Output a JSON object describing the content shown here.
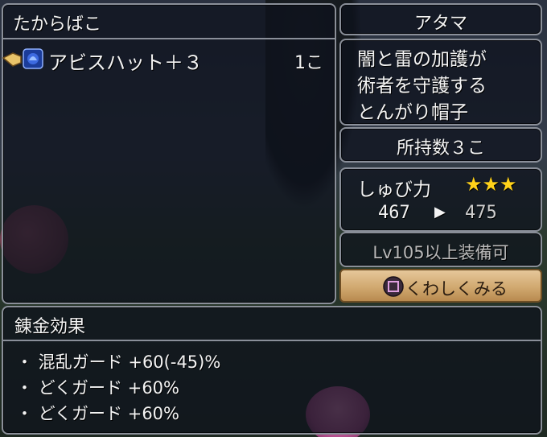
{
  "chest_panel": {
    "title": "たからばこ",
    "item_name": "アビスハット＋３",
    "item_count": "1こ"
  },
  "slot_panel": {
    "label": "アタマ"
  },
  "description": {
    "lines": [
      "闇と雷の加護が",
      "術者を守護する",
      "とんがり帽子"
    ]
  },
  "owned": {
    "text": "所持数３こ"
  },
  "defense": {
    "label": "しゅび力",
    "stars": "★★★",
    "current": "467",
    "arrow": "▶",
    "next": "475"
  },
  "requirement": {
    "text": "Lv105以上装備可"
  },
  "details_button": {
    "label": "くわしくみる"
  },
  "alchemy": {
    "title": "錬金効果",
    "effects": [
      "・ 混乱ガード +60(-45)%",
      "・ どくガード +60%",
      "・ どくガード +60%"
    ]
  },
  "colors": {
    "star": "#ffd21a",
    "requirement_text": "#b9b9b9",
    "button_bg": "#d1a970"
  }
}
